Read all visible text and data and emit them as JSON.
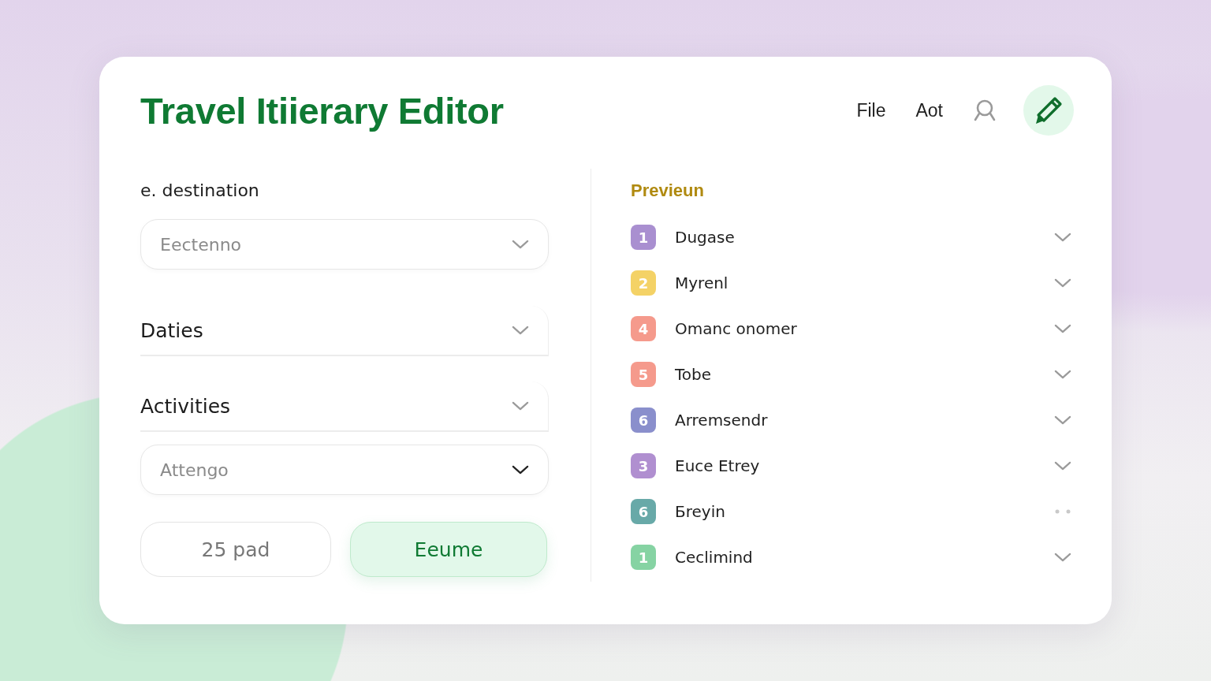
{
  "header": {
    "title": "Travel Itiierary Editor",
    "menu": [
      "File",
      "Aot"
    ]
  },
  "form": [
    {
      "kind": "label",
      "text": "e. destination"
    },
    {
      "kind": "select",
      "placeholder": "Eectenno"
    },
    {
      "kind": "section",
      "text": "Daties"
    },
    {
      "kind": "section",
      "text": "Activities"
    },
    {
      "kind": "select",
      "placeholder": "Attengo"
    }
  ],
  "buttons": [
    {
      "label": "25 pad",
      "kind": "secondary"
    },
    {
      "label": "Eeume",
      "kind": "primary"
    }
  ],
  "preview": {
    "title": "Previeun",
    "items": [
      {
        "number": "1",
        "label": "Dugase",
        "color": "#a98fd0",
        "kind": "chevron"
      },
      {
        "number": "2",
        "label": "Myrenl",
        "color": "#f4d266",
        "kind": "chevron"
      },
      {
        "number": "4",
        "label": "Omanc onomer",
        "color": "#f59a8c",
        "kind": "chevron"
      },
      {
        "number": "5",
        "label": "Tobe",
        "color": "#f59a8c",
        "kind": "chevron"
      },
      {
        "number": "6",
        "label": "Arremsendr",
        "color": "#8a8fcc",
        "kind": "chevron"
      },
      {
        "number": "3",
        "label": "Euce Etrey",
        "color": "#b08fd0",
        "kind": "chevron"
      },
      {
        "number": "6",
        "label": "Ƃreyin",
        "color": "#68a9a8",
        "kind": "dots"
      },
      {
        "number": "1",
        "label": "Ceclimind",
        "color": "#86d3a3",
        "kind": "chevron"
      }
    ]
  }
}
